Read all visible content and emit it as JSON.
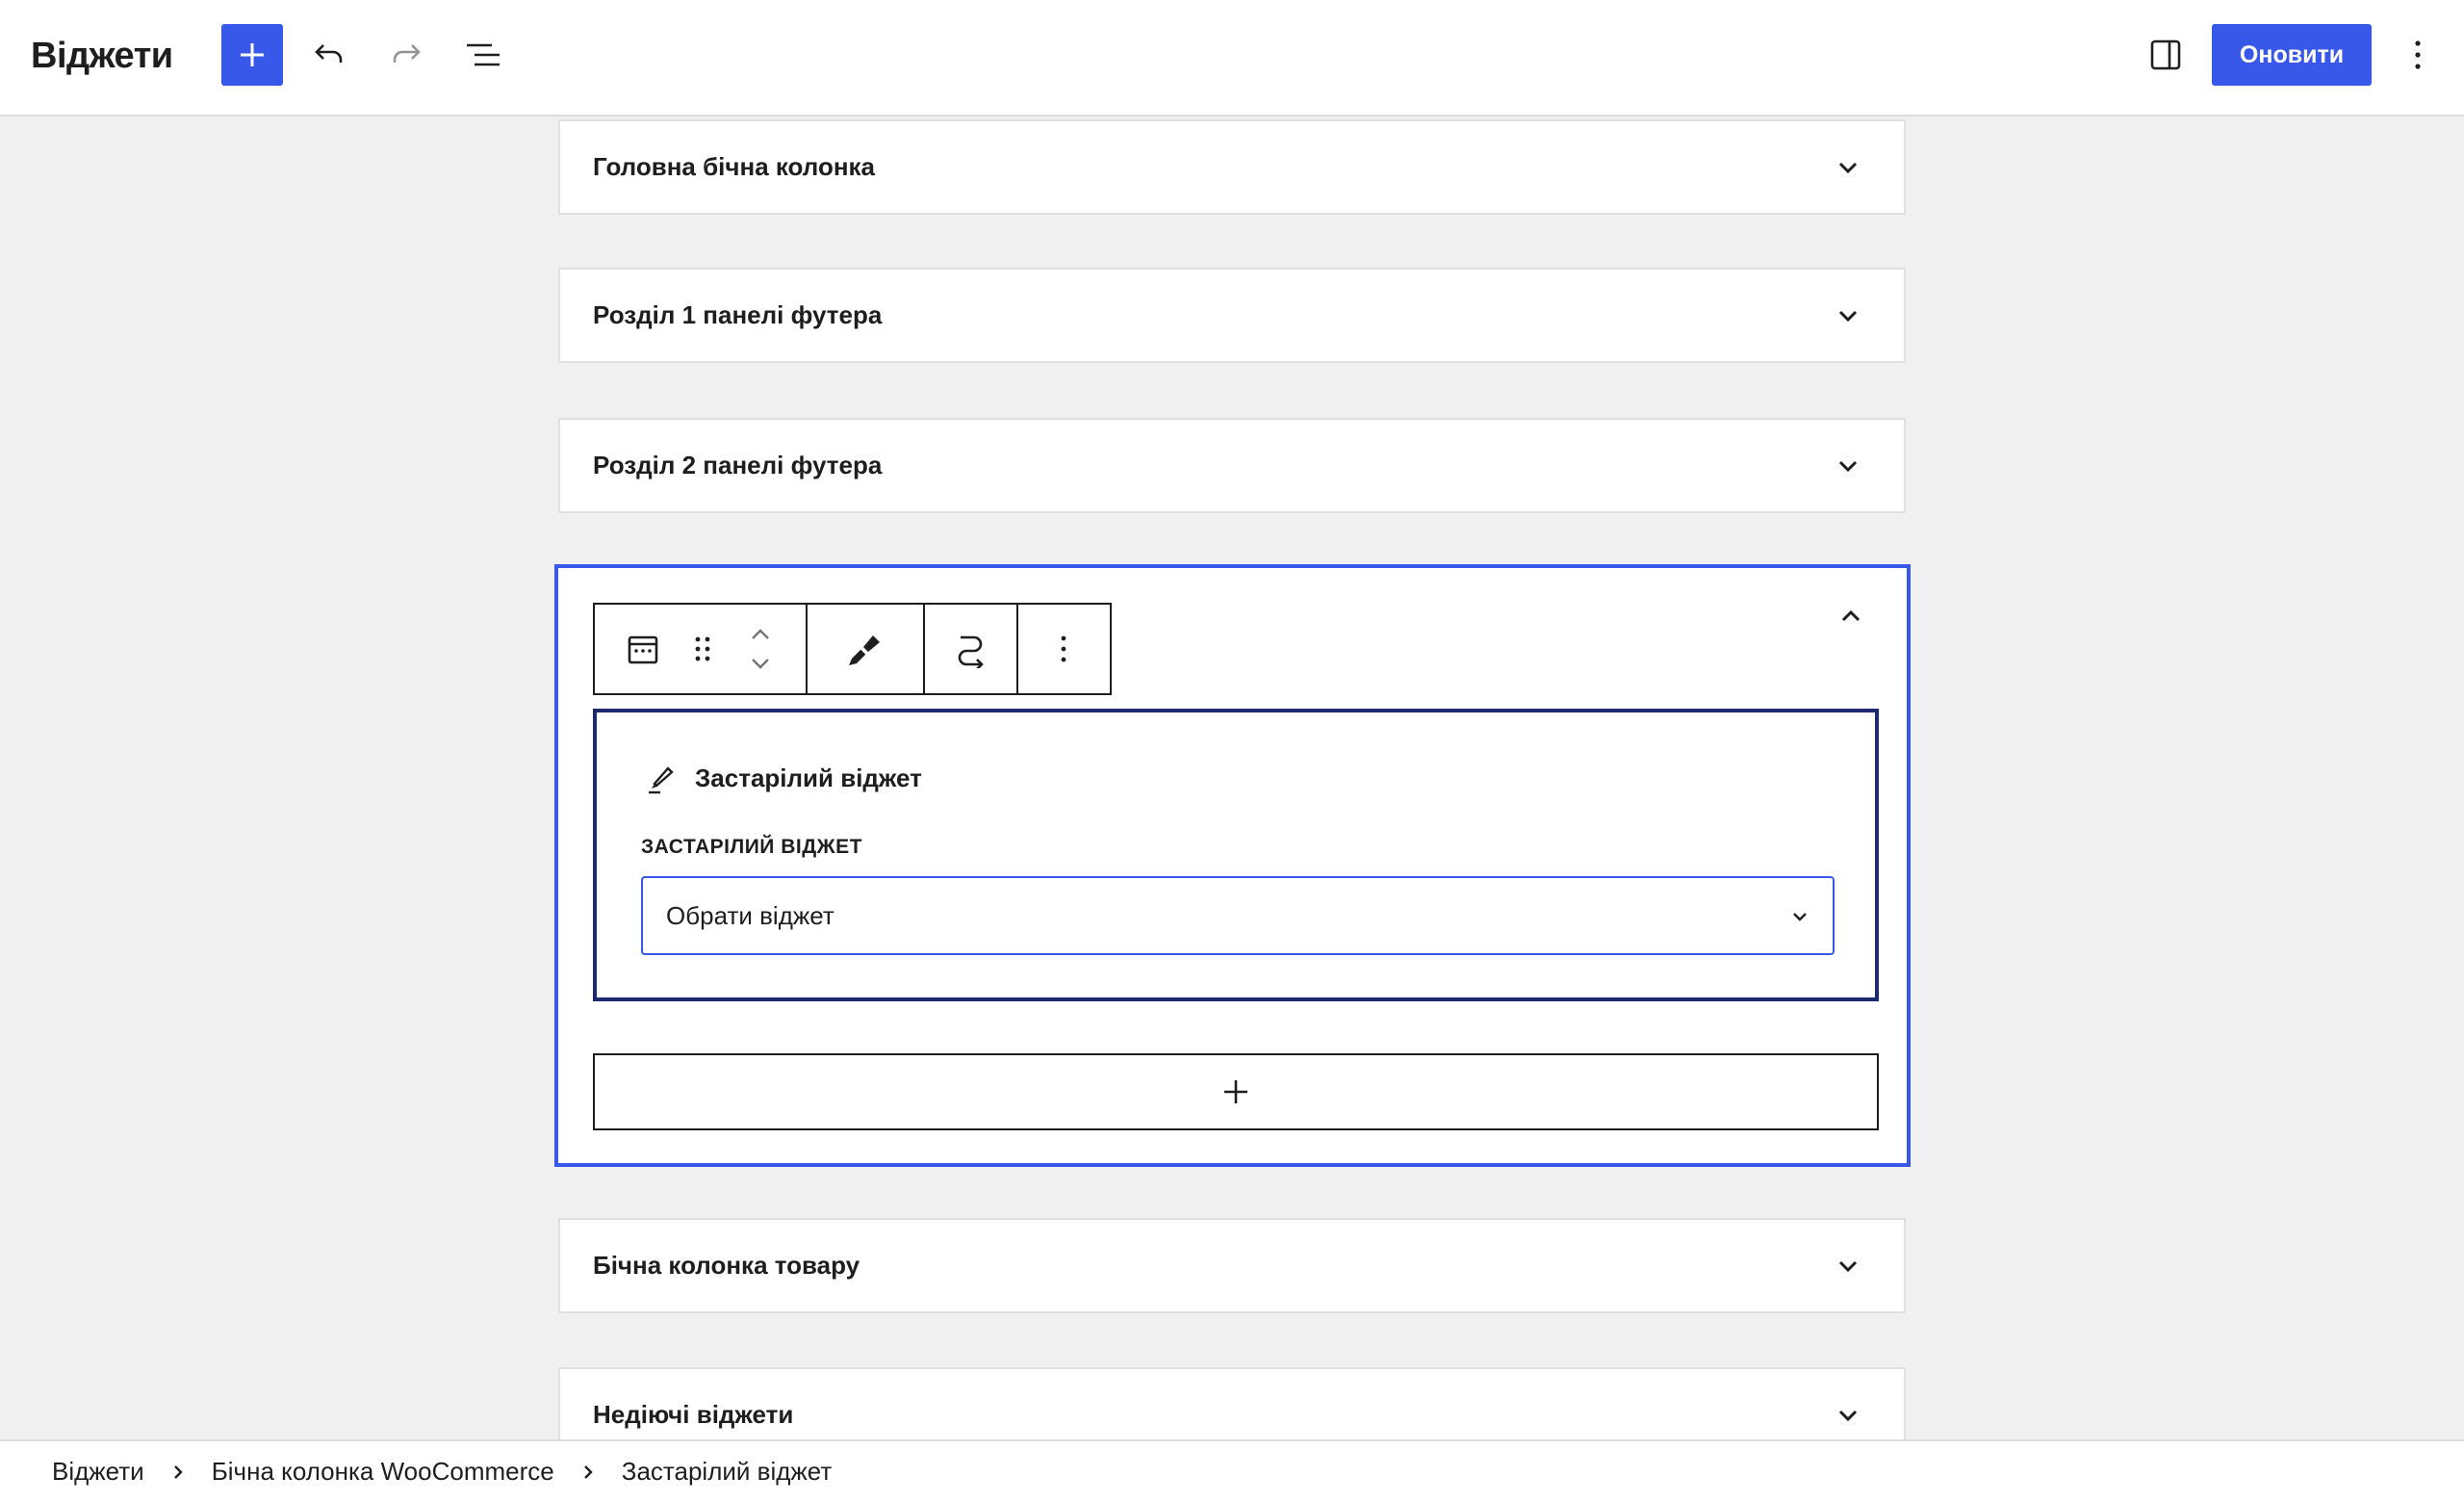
{
  "header": {
    "title": "Віджети",
    "update_label": "Оновити"
  },
  "areas": [
    {
      "title": "Головна бічна колонка"
    },
    {
      "title": "Розділ 1 панелі футера"
    },
    {
      "title": "Розділ 2 панелі футера"
    },
    {
      "title": "Бічна колонка товару"
    },
    {
      "title": "Недіючі віджети"
    }
  ],
  "legacy_widget": {
    "title": "Застарілий віджет",
    "field_label": "ЗАСТАРІЛИЙ ВІДЖЕТ",
    "select_value": "Обрати віджет"
  },
  "breadcrumb": [
    "Віджети",
    "Бічна колонка WooCommerce",
    "Застарілий віджет"
  ],
  "colors": {
    "accent": "#3858e9",
    "widget_border": "#1e2a6e"
  }
}
